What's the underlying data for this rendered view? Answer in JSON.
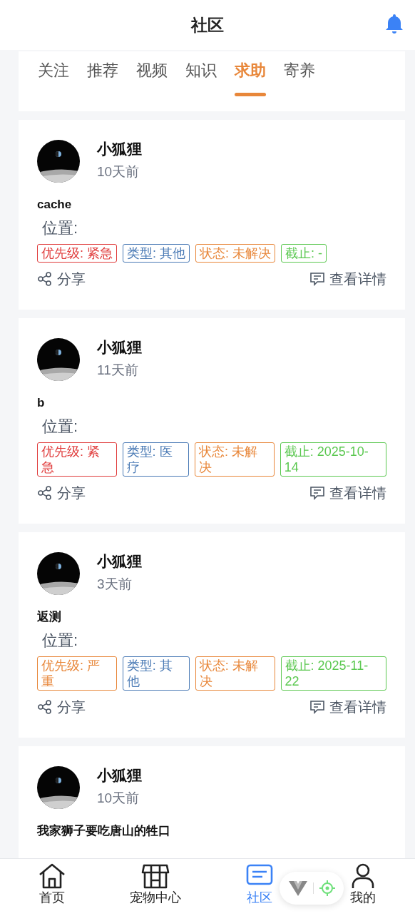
{
  "header": {
    "title": "社区"
  },
  "tabs": [
    {
      "label": "关注",
      "selected": false
    },
    {
      "label": "推荐",
      "selected": false
    },
    {
      "label": "视频",
      "selected": false
    },
    {
      "label": "知识",
      "selected": false
    },
    {
      "label": "求助",
      "selected": true
    },
    {
      "label": "寄养",
      "selected": false
    }
  ],
  "posts": [
    {
      "author": "小狐狸",
      "time": "10天前",
      "title": "cache",
      "location": "位置:",
      "tags": [
        {
          "text": "优先级: 紧急",
          "color": "#e03c3c"
        },
        {
          "text": "类型: 其他",
          "color": "#4a7ab5"
        },
        {
          "text": "状态: 未解决",
          "color": "#e8873a"
        },
        {
          "text": "截止: -",
          "color": "#5bc850"
        }
      ],
      "share": "分享",
      "details": "查看详情"
    },
    {
      "author": "小狐狸",
      "time": "11天前",
      "title": "b",
      "location": "位置:",
      "tags": [
        {
          "text": "优先级: 紧急",
          "color": "#e03c3c"
        },
        {
          "text": "类型: 医疗",
          "color": "#4a7ab5"
        },
        {
          "text": "状态: 未解决",
          "color": "#e8873a"
        },
        {
          "text": "截止: 2025-10-14",
          "color": "#5bc850"
        }
      ],
      "share": "分享",
      "details": "查看详情"
    },
    {
      "author": "小狐狸",
      "time": "3天前",
      "title": "返测",
      "location": "位置:",
      "tags": [
        {
          "text": "优先级: 严重",
          "color": "#e8873a"
        },
        {
          "text": "类型: 其他",
          "color": "#4a7ab5"
        },
        {
          "text": "状态: 未解决",
          "color": "#e8873a"
        },
        {
          "text": "截止: 2025-11-22",
          "color": "#5bc850"
        }
      ],
      "share": "分享",
      "details": "查看详情"
    },
    {
      "author": "小狐狸",
      "time": "10天前",
      "title": "我家狮子要吃唐山的牲口"
    }
  ],
  "bottom_nav": [
    {
      "label": "首页",
      "kind": "home",
      "selected": false
    },
    {
      "label": "宠物中心",
      "kind": "store",
      "selected": false
    },
    {
      "label": "社区",
      "kind": "community",
      "selected": true
    },
    {
      "label": "我的",
      "kind": "profile",
      "selected": false
    }
  ]
}
